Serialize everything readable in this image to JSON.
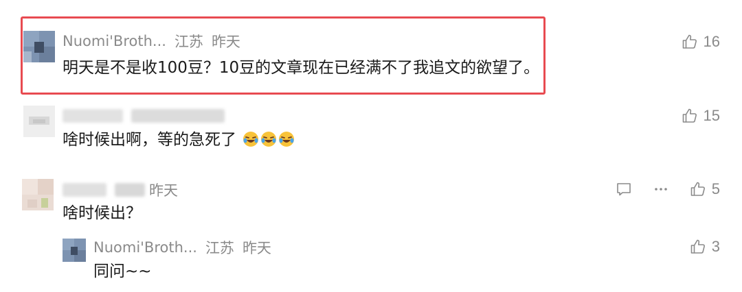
{
  "comments": [
    {
      "author": "Nuomi'Broth...",
      "location": "江苏",
      "time": "昨天",
      "text": "明天是不是收100豆？10豆的文章现在已经满不了我追文的欲望了。",
      "likes": "16",
      "highlighted": true
    },
    {
      "author": "",
      "location": "",
      "time": "",
      "text": "啥时候出啊，等的急死了",
      "emoji_count": 3,
      "emoji_icon": "crying-laughing-emoji-icon",
      "likes": "15"
    },
    {
      "author": "",
      "location": "",
      "time": "昨天",
      "text": "啥时候出？",
      "likes": "5",
      "replies": [
        {
          "author": "Nuomi'Broth...",
          "location": "江苏",
          "time": "昨天",
          "text": "同问~~",
          "likes": "3"
        }
      ]
    }
  ],
  "icons": {
    "like": "thumbs-up-icon",
    "reply": "reply-bubble-icon",
    "more": "more-dots-icon"
  },
  "colors": {
    "highlight_border": "#e84a50",
    "meta_text": "#8a8a8a",
    "body_text": "#1a1a1a"
  }
}
